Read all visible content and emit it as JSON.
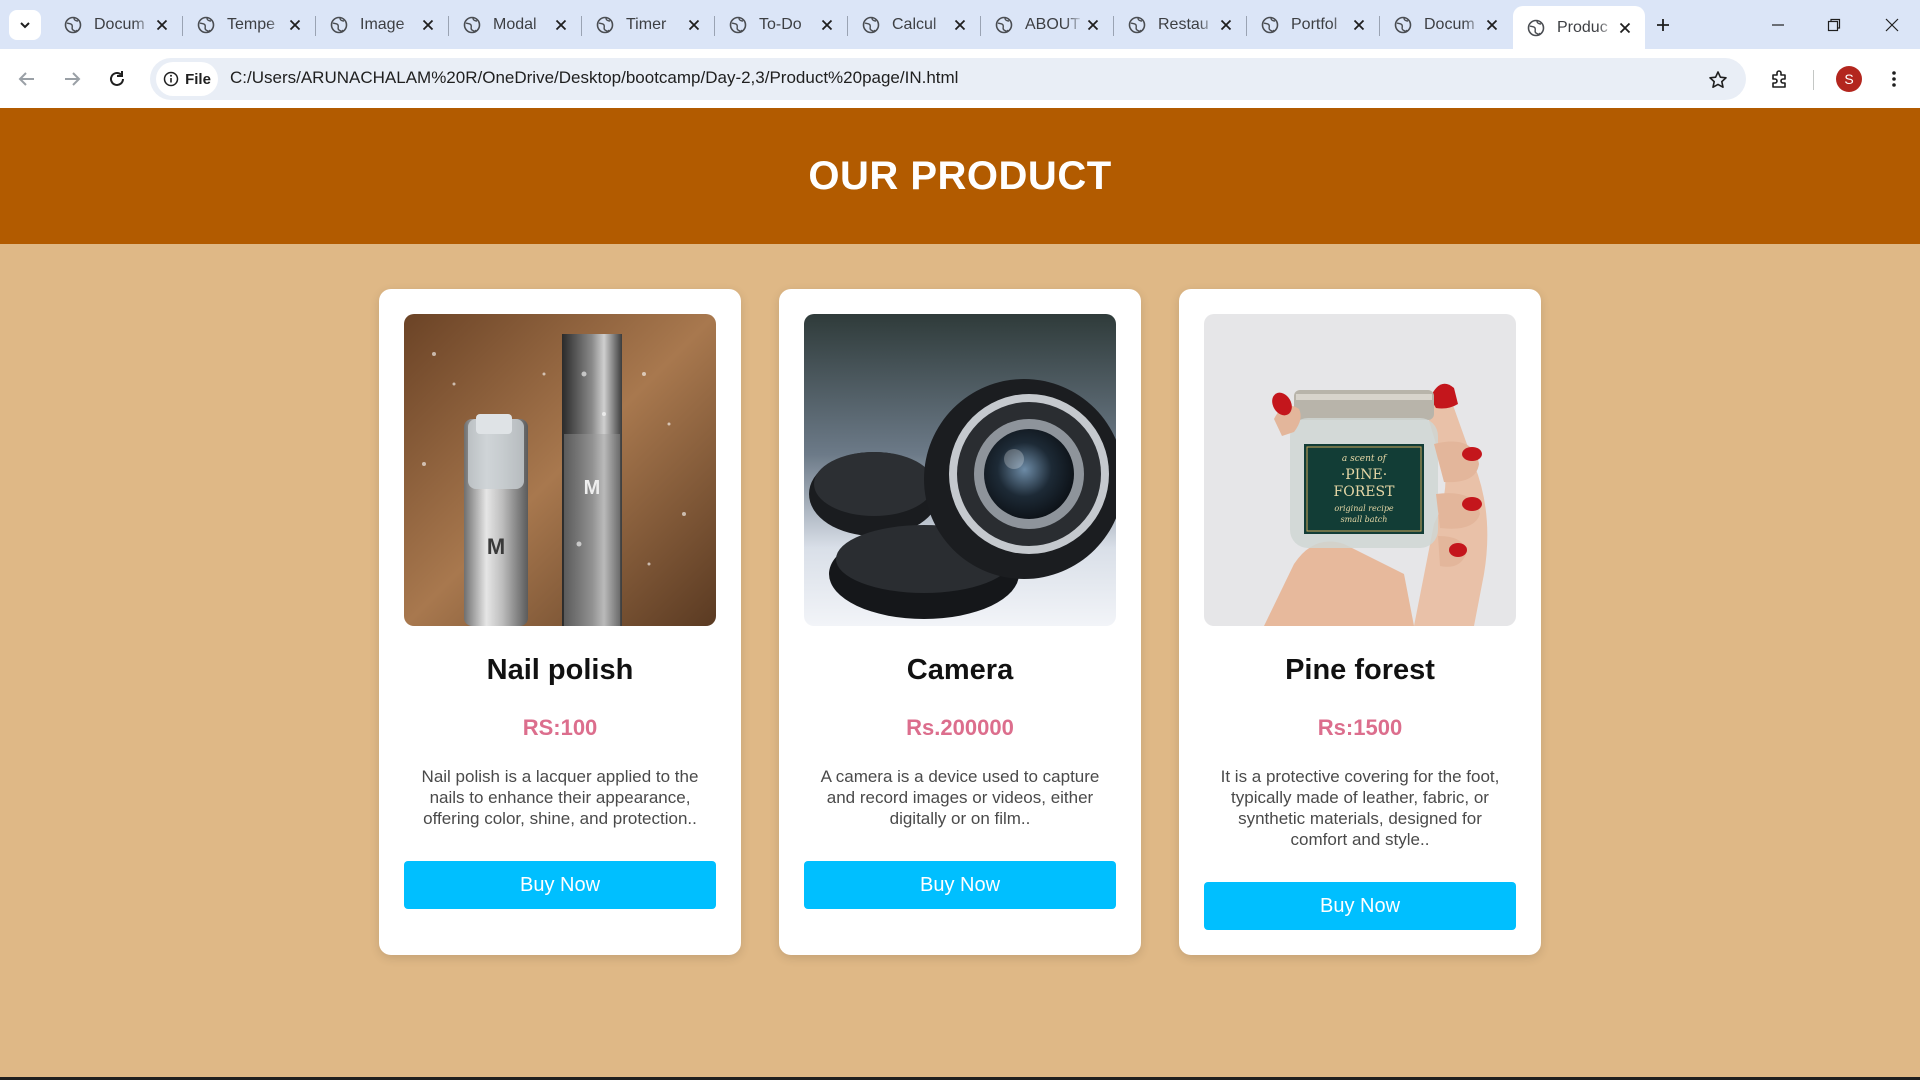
{
  "browser": {
    "tabs": [
      {
        "title": "Docum"
      },
      {
        "title": "Tempe"
      },
      {
        "title": "Image"
      },
      {
        "title": "Modal"
      },
      {
        "title": "Timer"
      },
      {
        "title": "To-Do"
      },
      {
        "title": "Calcul"
      },
      {
        "title": "ABOUT"
      },
      {
        "title": "Restau"
      },
      {
        "title": "Portfol"
      },
      {
        "title": "Docum"
      },
      {
        "title": "Produc"
      }
    ],
    "active_tab_index": 11,
    "chip_label": "File",
    "url": "C:/Users/ARUNACHALAM%20R/OneDrive/Desktop/bootcamp/Day-2,3/Product%20page/IN.html",
    "profile_initial": "S"
  },
  "page": {
    "title": "OUR PRODUCT",
    "products": [
      {
        "name": "Nail polish",
        "price": "RS:100",
        "description": "Nail polish is a lacquer applied to the nails to enhance their appearance, offering color, shine, and protection..",
        "button": "Buy Now"
      },
      {
        "name": "Camera",
        "price": "Rs.200000",
        "description": "A camera is a device used to capture and record images or videos, either digitally or on film..",
        "button": "Buy Now"
      },
      {
        "name": "Pine forest",
        "price": "Rs:1500",
        "description": "It is a protective covering for the foot, typically made of leather, fabric, or synthetic materials, designed for comfort and style..",
        "button": "Buy Now"
      }
    ]
  },
  "jar_label": {
    "line1": "a scent of",
    "line2": "·PINE·",
    "line3": "FOREST",
    "line4": "original recipe",
    "line5": "small batch"
  },
  "colors": {
    "header_bg": "#b25b00",
    "page_bg": "#dfb886",
    "price": "#dc6e8d",
    "button": "#00bfff"
  }
}
